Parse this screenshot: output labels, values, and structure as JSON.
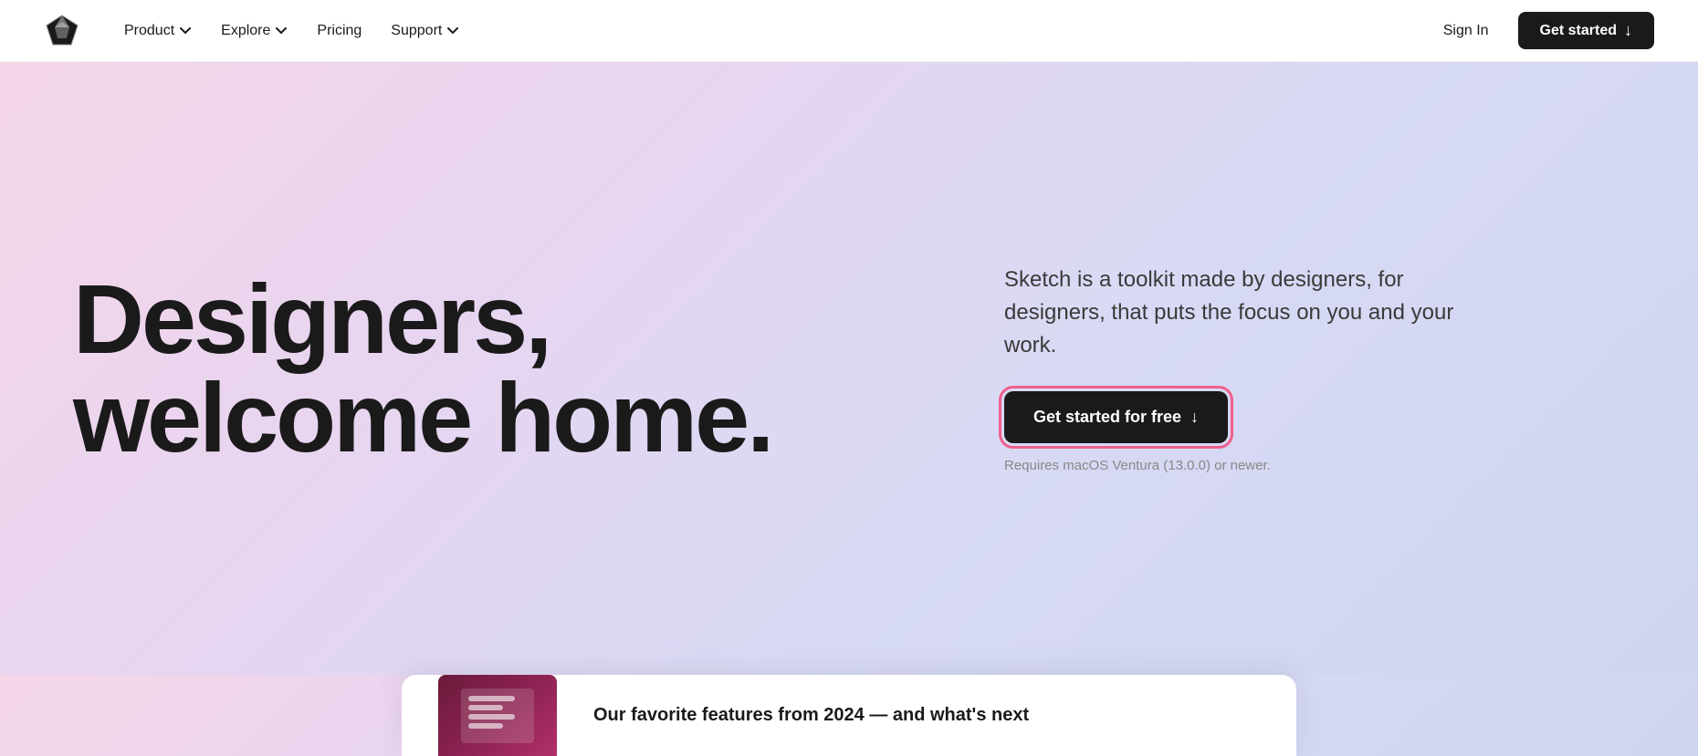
{
  "navbar": {
    "logo_alt": "Sketch logo",
    "nav_items": [
      {
        "label": "Product",
        "has_dropdown": true
      },
      {
        "label": "Explore",
        "has_dropdown": true
      },
      {
        "label": "Pricing",
        "has_dropdown": false
      },
      {
        "label": "Support",
        "has_dropdown": true
      }
    ],
    "sign_in_label": "Sign In",
    "get_started_label": "Get started"
  },
  "hero": {
    "headline_line1": "Designers,",
    "headline_line2": "welcome home.",
    "description": "Sketch is a toolkit made by designers, for designers, that puts the focus on you and your work.",
    "cta_label": "Get started for free",
    "requirement_text": "Requires macOS Ventura (13.0.0) or newer."
  },
  "feature_card": {
    "label": "Our favorite features from 2024 — and what's next"
  }
}
